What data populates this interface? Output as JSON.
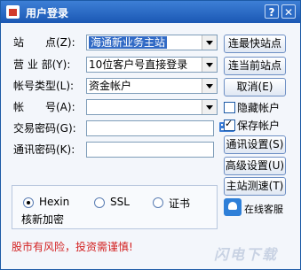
{
  "window": {
    "title": "用户登录",
    "help_label": "?",
    "close_label": "✕"
  },
  "form": {
    "site_label": "站　　点(Z):",
    "site_value": "海通新业务主站",
    "dept_label": "营 业 部(Y):",
    "dept_value": "10位客户号直接登录",
    "acct_type_label": "帐号类型(L):",
    "acct_type_value": "资金帐户",
    "account_label": "帐　　号(A):",
    "account_value": "",
    "trade_pwd_label": "交易密码(G):",
    "trade_pwd_value": "",
    "comm_pwd_label": "通讯密码(K):",
    "comm_pwd_value": ""
  },
  "buttons": {
    "fastest_site": "连最快站点",
    "current_site": "连当前站点",
    "cancel": "取消(E)",
    "comm_settings": "通讯设置(S)",
    "advanced_settings": "高级设置(U)",
    "site_speed_test": "主站测速(T)"
  },
  "options": {
    "hide_account": "隐藏帐户",
    "save_account": "保存帐户"
  },
  "encryption": {
    "hexin": "Hexin",
    "ssl": "SSL",
    "cert": "证书",
    "verify_label": "核新加密"
  },
  "warning": "股市有风险，投资需谨慎!",
  "service": {
    "label": "在线客服"
  },
  "watermark": "闪电下载"
}
